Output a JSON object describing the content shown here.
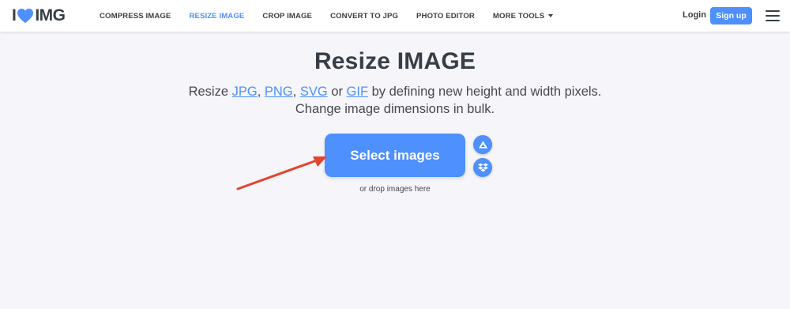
{
  "header": {
    "logo": {
      "prefix": "I",
      "suffix": "IMG"
    },
    "nav": [
      {
        "label": "COMPRESS IMAGE",
        "active": false
      },
      {
        "label": "RESIZE IMAGE",
        "active": true
      },
      {
        "label": "CROP IMAGE",
        "active": false
      },
      {
        "label": "CONVERT TO JPG",
        "active": false
      },
      {
        "label": "PHOTO EDITOR",
        "active": false
      },
      {
        "label": "MORE TOOLS",
        "active": false
      }
    ],
    "login_label": "Login",
    "signup_label": "Sign up"
  },
  "main": {
    "title": "Resize IMAGE",
    "subtitle": {
      "prefix": "Resize ",
      "formats": [
        "JPG",
        "PNG",
        "SVG",
        "GIF"
      ],
      "sep1": ", ",
      "sep2": ", ",
      "sep3": " or ",
      "suffix": " by defining new height and width pixels.",
      "line2": "Change image dimensions in bulk."
    },
    "select_button_label": "Select images",
    "drop_text": "or drop images here"
  },
  "icons": {
    "logo_heart": "heart-icon",
    "cloud_top": "google-drive-icon",
    "cloud_bottom": "dropbox-icon",
    "menu": "hamburger-menu-icon",
    "more_caret": "caret-down-icon"
  },
  "colors": {
    "accent": "#4d90fe",
    "text": "#383e45",
    "background": "#f5f5fa",
    "arrow": "#e5432d"
  }
}
